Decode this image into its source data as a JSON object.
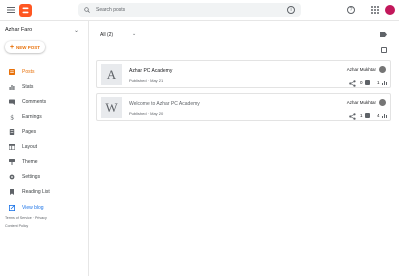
{
  "search": {
    "placeholder": "Search posts"
  },
  "sidebar": {
    "blog_name": "Azhar Faro",
    "new_post_label": "NEW POST",
    "items": [
      {
        "label": "Posts",
        "icon": "posts-icon",
        "active": true
      },
      {
        "label": "Stats",
        "icon": "stats-icon"
      },
      {
        "label": "Comments",
        "icon": "comments-icon"
      },
      {
        "label": "Earnings",
        "icon": "earnings-icon"
      },
      {
        "label": "Pages",
        "icon": "pages-icon"
      },
      {
        "label": "Layout",
        "icon": "layout-icon"
      },
      {
        "label": "Theme",
        "icon": "theme-icon"
      },
      {
        "label": "Settings",
        "icon": "settings-icon"
      },
      {
        "label": "Reading List",
        "icon": "reading-list-icon"
      }
    ],
    "view_blog_label": "View blog",
    "footer_links": [
      "Terms of Service",
      "Privacy",
      "Content Policy"
    ],
    "footer_line1": "Terms of Service · Privacy",
    "footer_line2": "Content Policy"
  },
  "main": {
    "filter_label": "All (2)",
    "posts": [
      {
        "thumb_letter": "A",
        "title": "Azhar PC Academy",
        "status": "Published · May 21",
        "author": "Azhar Mukhtar",
        "comments": "0",
        "views": "1"
      },
      {
        "thumb_letter": "W",
        "title": "Welcome to Azhar PC Academy",
        "status": "Published · May 20",
        "author": "Azhar Mukhtar",
        "comments": "1",
        "views": "4"
      }
    ]
  },
  "colors": {
    "accent": "#e8710a",
    "logo": "#ff5722",
    "link": "#1a73e8",
    "avatar": "#c2185b"
  }
}
